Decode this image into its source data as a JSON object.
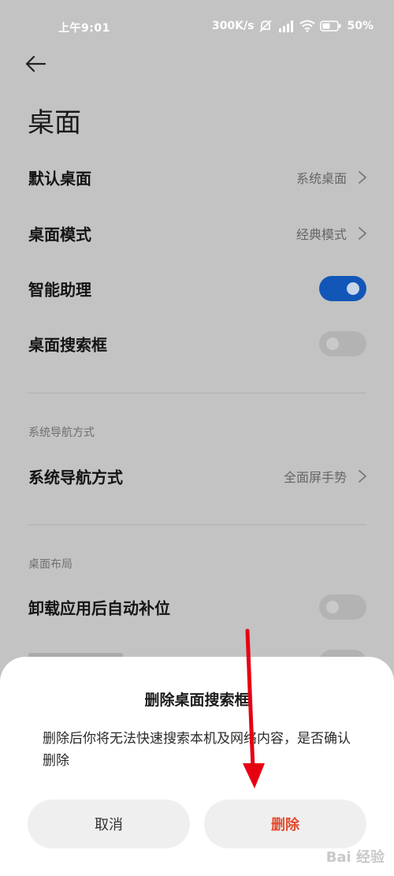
{
  "status": {
    "time": "上午9:01",
    "speed": "300K/s",
    "battery": "50%"
  },
  "page": {
    "title": "桌面"
  },
  "settings": [
    {
      "label": "默认桌面",
      "value": "系统桌面",
      "kind": "link"
    },
    {
      "label": "桌面模式",
      "value": "经典模式",
      "kind": "link"
    },
    {
      "label": "智能助理",
      "kind": "toggle",
      "on": true
    },
    {
      "label": "桌面搜索框",
      "kind": "toggle",
      "on": false
    }
  ],
  "nav_section": {
    "header": "系统导航方式",
    "row": {
      "label": "系统导航方式",
      "value": "全面屏手势"
    }
  },
  "layout_section": {
    "header": "桌面布局",
    "row": {
      "label": "卸载应用后自动补位",
      "on": false
    }
  },
  "dialog": {
    "title": "删除桌面搜索框",
    "message": "删除后你将无法快速搜索本机及网络内容，是否确认删除",
    "cancel": "取消",
    "confirm": "删除"
  },
  "watermark": "Bai 经验",
  "colors": {
    "accent": "#1256b8",
    "danger": "#e24a2e",
    "annotation": "#e60012"
  }
}
